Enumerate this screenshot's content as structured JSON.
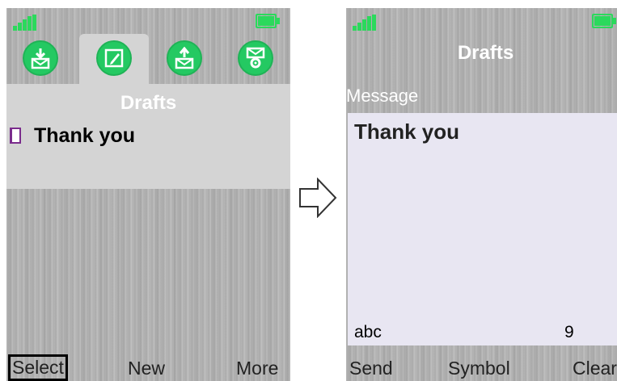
{
  "left_screen": {
    "tabs": [
      {
        "icon": "inbox-download-icon"
      },
      {
        "icon": "compose-edit-icon",
        "active": true
      },
      {
        "icon": "outbox-upload-icon"
      },
      {
        "icon": "message-settings-icon"
      }
    ],
    "title": "Drafts",
    "list": [
      {
        "label": "Thank you",
        "icon": "draft-document-icon"
      }
    ],
    "softkeys": {
      "left": "Select",
      "center": "New",
      "right": "More"
    }
  },
  "right_screen": {
    "title": "Drafts",
    "field_label": "Message",
    "message": "Thank you",
    "input_mode": "abc",
    "char_count": "9",
    "softkeys": {
      "left": "Send",
      "center": "Symbol",
      "right": "Clear"
    }
  },
  "colors": {
    "accent": "#2bd95c",
    "tab_icon": "#24c962"
  }
}
